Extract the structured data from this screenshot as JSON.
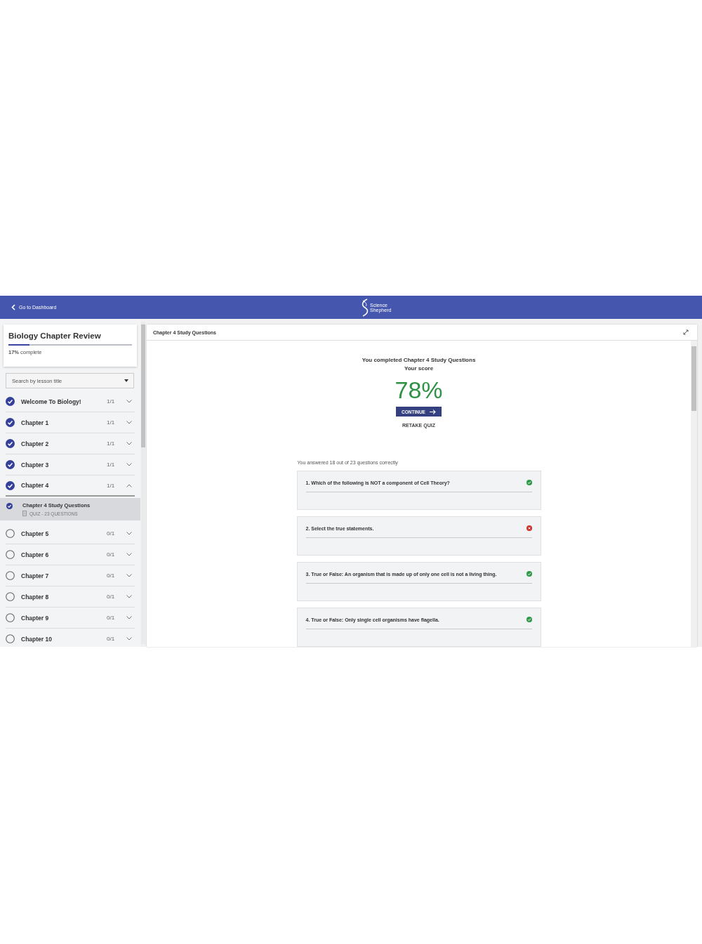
{
  "header": {
    "back_link": "Go to Dashboard",
    "logo_text": "Science Shepherd"
  },
  "sidebar": {
    "course": {
      "title": "Biology Chapter Review",
      "level": 0.17,
      "progress_text": "**17%** complete"
    },
    "search": {
      "placeholder": "Search by lesson title"
    },
    "chapters": [
      {
        "title": "Welcome To Biology!",
        "progress": "1/1",
        "completed": true,
        "expanded": false
      },
      {
        "title": "Chapter 1",
        "progress": "1/1",
        "completed": true,
        "expanded": false
      },
      {
        "title": "Chapter 2",
        "progress": "1/1",
        "completed": true,
        "expanded": false
      },
      {
        "title": "Chapter 3",
        "progress": "1/1",
        "completed": true,
        "expanded": false
      },
      {
        "title": "Chapter 4",
        "progress": "1/1",
        "completed": true,
        "expanded": true,
        "children": [
          {
            "title": "Chapter 4 Study Questions",
            "meta": "QUIZ - 23 QUESTIONS",
            "completed": true,
            "selected": true
          }
        ]
      },
      {
        "title": "Chapter 5",
        "progress": "0/1",
        "completed": false,
        "expanded": false
      },
      {
        "title": "Chapter 6",
        "progress": "0/1",
        "completed": false,
        "expanded": false
      },
      {
        "title": "Chapter 7",
        "progress": "0/1",
        "completed": false,
        "expanded": false
      },
      {
        "title": "Chapter 8",
        "progress": "0/1",
        "completed": false,
        "expanded": false
      },
      {
        "title": "Chapter 9",
        "progress": "0/1",
        "completed": false,
        "expanded": false
      },
      {
        "title": "Chapter 10",
        "progress": "0/1",
        "completed": false,
        "expanded": false
      }
    ]
  },
  "main": {
    "title": "Chapter 4 Study Questions",
    "completion_text": "You completed Chapter 4 Study Questions",
    "score_label": "Your score",
    "score": "78%",
    "continue_button": "CONTINUE",
    "retake_link": "RETAKE QUIZ",
    "summary": "You answered 18 out of 23 questions correctly",
    "questions": [
      {
        "text": "1. Which of the following is NOT a component of Cell Theory?",
        "correct": true
      },
      {
        "text": "2. Select the true statements.",
        "correct": false
      },
      {
        "text": "3. True or False: An organism that is made up of only one cell is not a living thing.",
        "correct": true
      },
      {
        "text": "4. True or False: Only single cell organisms have flagella.",
        "correct": true
      }
    ]
  }
}
